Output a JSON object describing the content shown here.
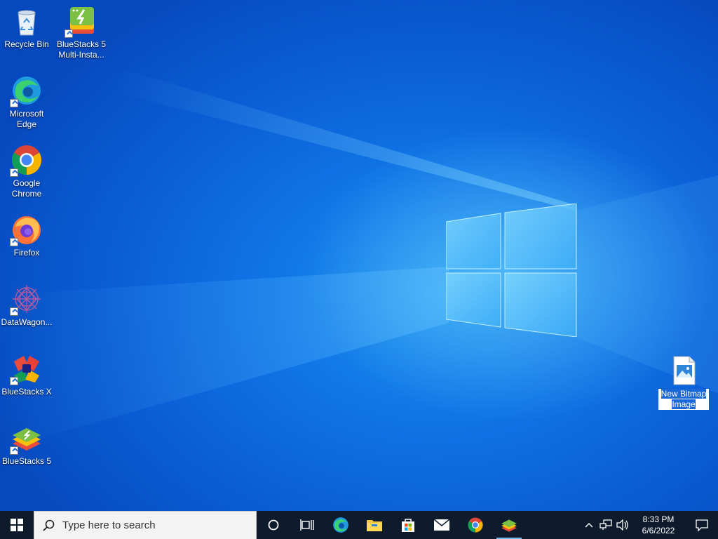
{
  "desktop": {
    "icons": [
      {
        "label": "Recycle Bin",
        "icon": "recycle-bin-icon"
      },
      {
        "label": "BlueStacks 5 Multi-Insta...",
        "icon": "bluestacks-multi-instance-icon"
      },
      {
        "label": "Microsoft Edge",
        "icon": "edge-icon"
      },
      {
        "label": "Google Chrome",
        "icon": "chrome-icon"
      },
      {
        "label": "Firefox",
        "icon": "firefox-icon"
      },
      {
        "label": "DataWagon...",
        "icon": "datawagon-icon"
      },
      {
        "label": "BlueStacks X",
        "icon": "bluestacks-x-icon"
      },
      {
        "label": "BlueStacks 5",
        "icon": "bluestacks-icon"
      },
      {
        "label": "New Bitmap Image",
        "icon": "bitmap-image-icon"
      }
    ]
  },
  "taskbar": {
    "search_placeholder": "Type here to search",
    "apps": [
      "cortana-icon",
      "task-view-icon",
      "edge-icon",
      "file-explorer-icon",
      "store-icon",
      "mail-icon",
      "chrome-icon",
      "bluestacks-icon"
    ],
    "clock": {
      "time": "8:33 PM",
      "date": "6/6/2022"
    }
  },
  "colors": {
    "taskbar": "#0d1b2d",
    "accent": "#0a5fd6",
    "selection": "#1a68d8"
  }
}
